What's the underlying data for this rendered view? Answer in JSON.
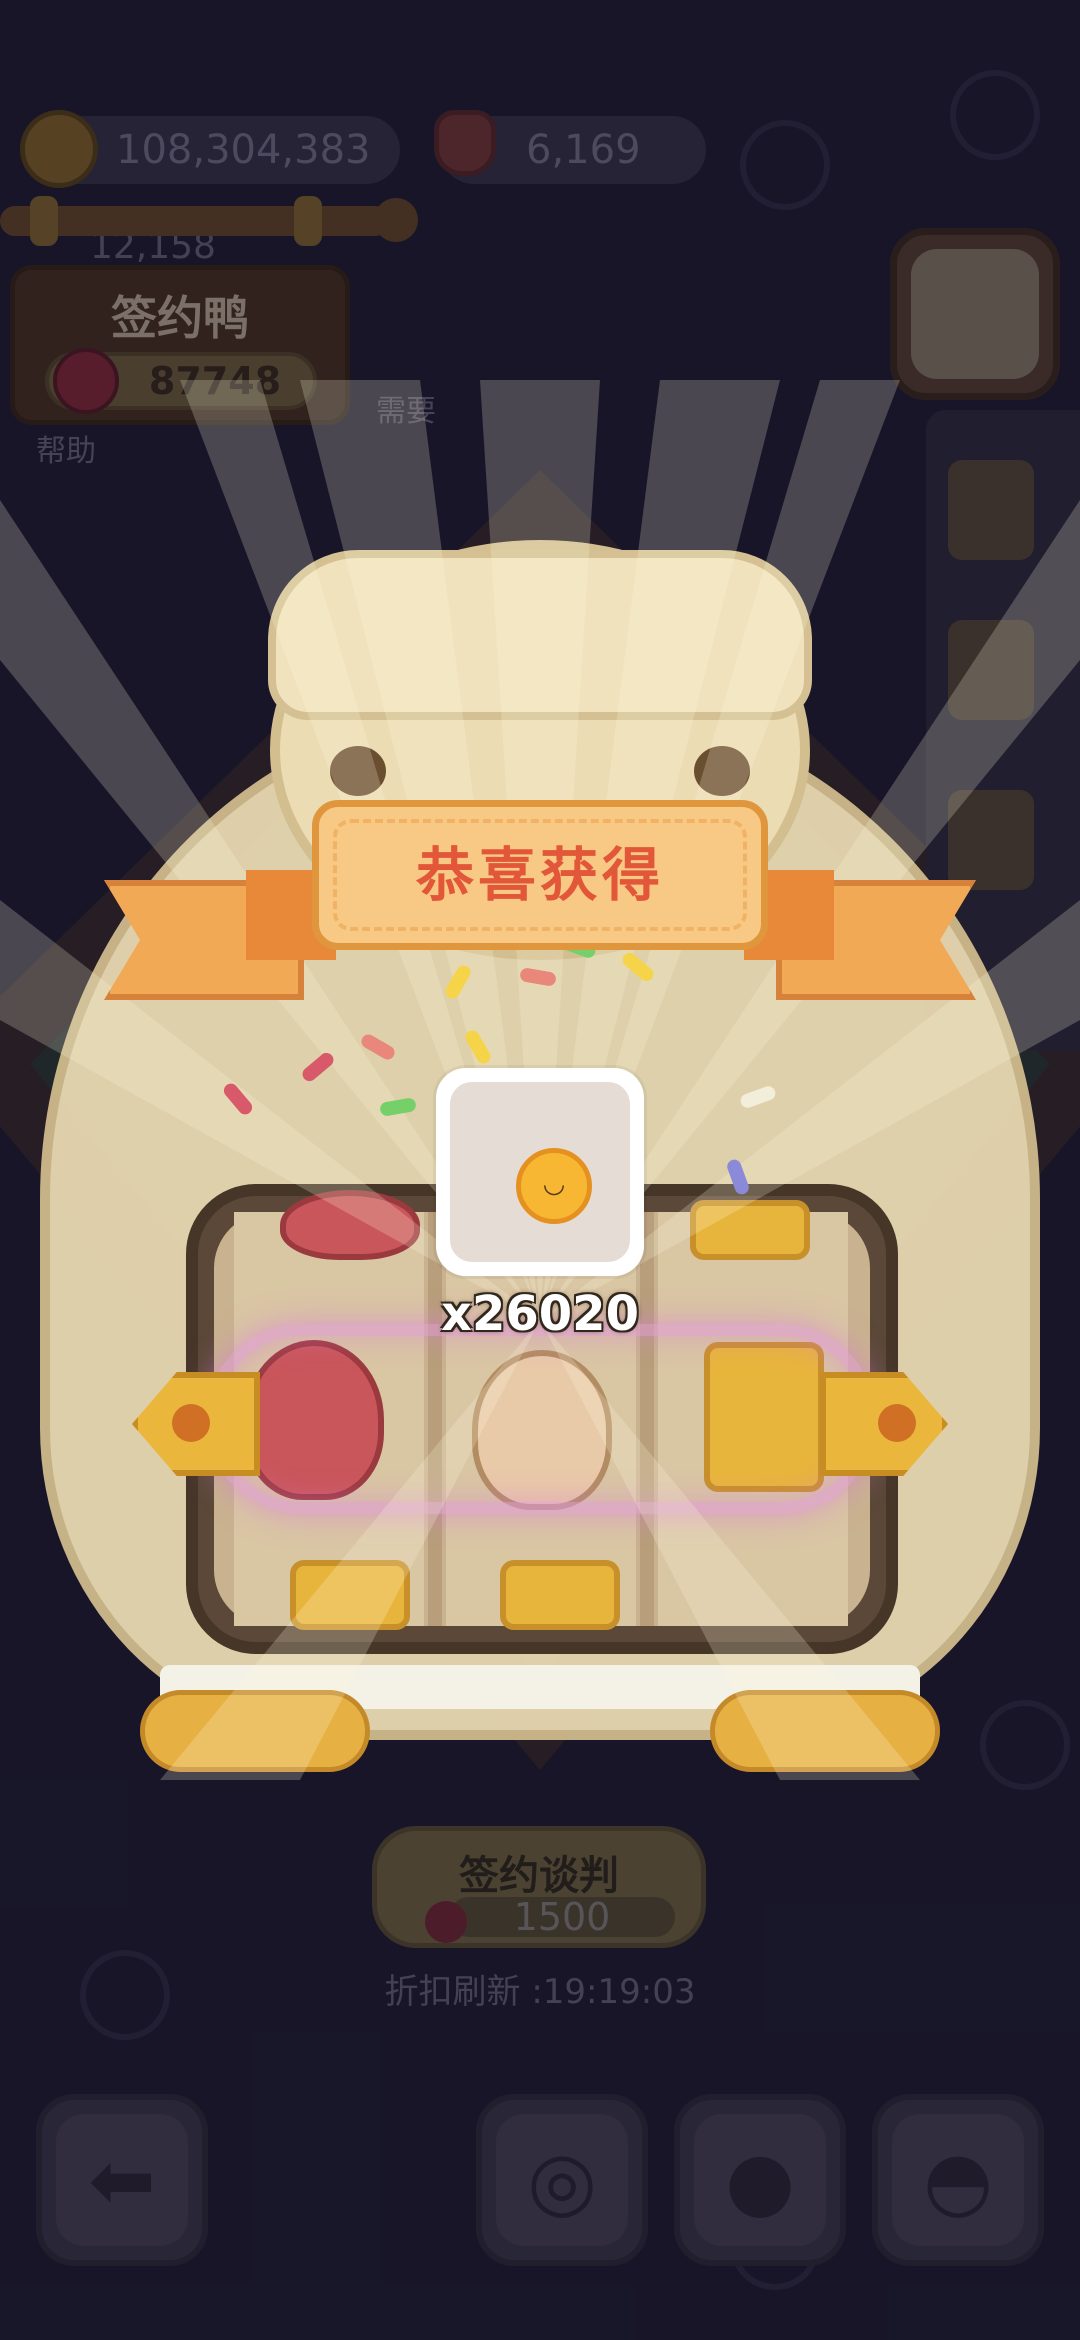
{
  "hud": {
    "coins": "108,304,383",
    "gems": "6,169",
    "partial_number": "12,158",
    "coin_icon": "cookie-coin-icon",
    "gem_icon": "strawberry-gem-icon"
  },
  "sign": {
    "title": "签约鸭",
    "flower_value": "87748",
    "flower_icon": "red-flower-icon"
  },
  "help_text": "需要\n帮助",
  "right_menu": {
    "contract_icon": "scroll-quill-icon",
    "items": [
      "stamp-duck-icon",
      "medal-star-icon",
      "bag-icon"
    ]
  },
  "reward_modal": {
    "banner_title": "恭喜获得",
    "item_icon": "cookie-coin-icon",
    "quantity": "x26020"
  },
  "negotiation": {
    "button_label": "签约谈判",
    "cost": "1500",
    "cost_icon": "red-flower-icon",
    "refresh_text": "折扣刷新 :19:19:03"
  },
  "bottom_bar": {
    "back_icon": "arrow-left-icon",
    "buttons": [
      "film-reel-icon",
      "duck-face-icon",
      "hard-hat-icon"
    ]
  },
  "colors": {
    "banner_fill": "#f8c984",
    "banner_text": "#e2573a",
    "background": "#1f1d33"
  }
}
